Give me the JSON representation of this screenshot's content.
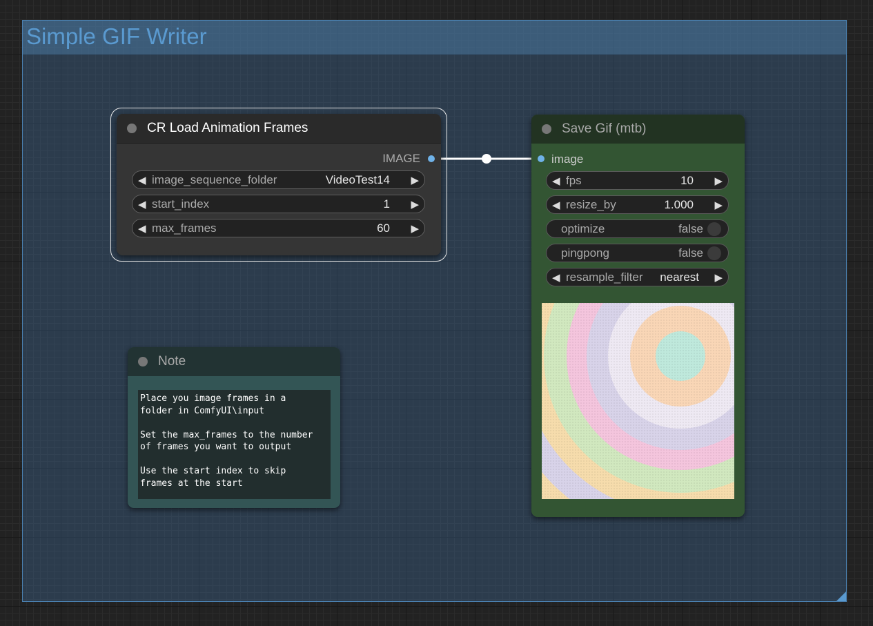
{
  "group": {
    "title": "Simple GIF Writer"
  },
  "cr_node": {
    "title": "CR Load Animation Frames",
    "output_label": "IMAGE",
    "widgets": [
      {
        "name": "image_sequence_folder",
        "value": "VideoTest14"
      },
      {
        "name": "start_index",
        "value": "1"
      },
      {
        "name": "max_frames",
        "value": "60"
      }
    ]
  },
  "save_gif": {
    "title": "Save Gif (mtb)",
    "input_label": "image",
    "fps": {
      "name": "fps",
      "value": "10"
    },
    "resize_by": {
      "name": "resize_by",
      "value": "1.000"
    },
    "optimize": {
      "name": "optimize",
      "value": "false"
    },
    "pingpong": {
      "name": "pingpong",
      "value": "false"
    },
    "resample_filter": {
      "name": "resample_filter",
      "value": "nearest"
    }
  },
  "note": {
    "title": "Note",
    "text": "Place you image frames in a\nfolder in ComfyUI\\input\n\nSet the max_frames to the number\nof frames you want to output\n\nUse the start index to skip\nframes at the start"
  },
  "icons": {
    "left": "triangle-left-icon",
    "right": "triangle-right-icon"
  },
  "colors": {
    "group_fill": "#3b628a",
    "save_gif_node": "#335533",
    "note_node": "#335555",
    "slot_blue": "#6fb2e8"
  }
}
